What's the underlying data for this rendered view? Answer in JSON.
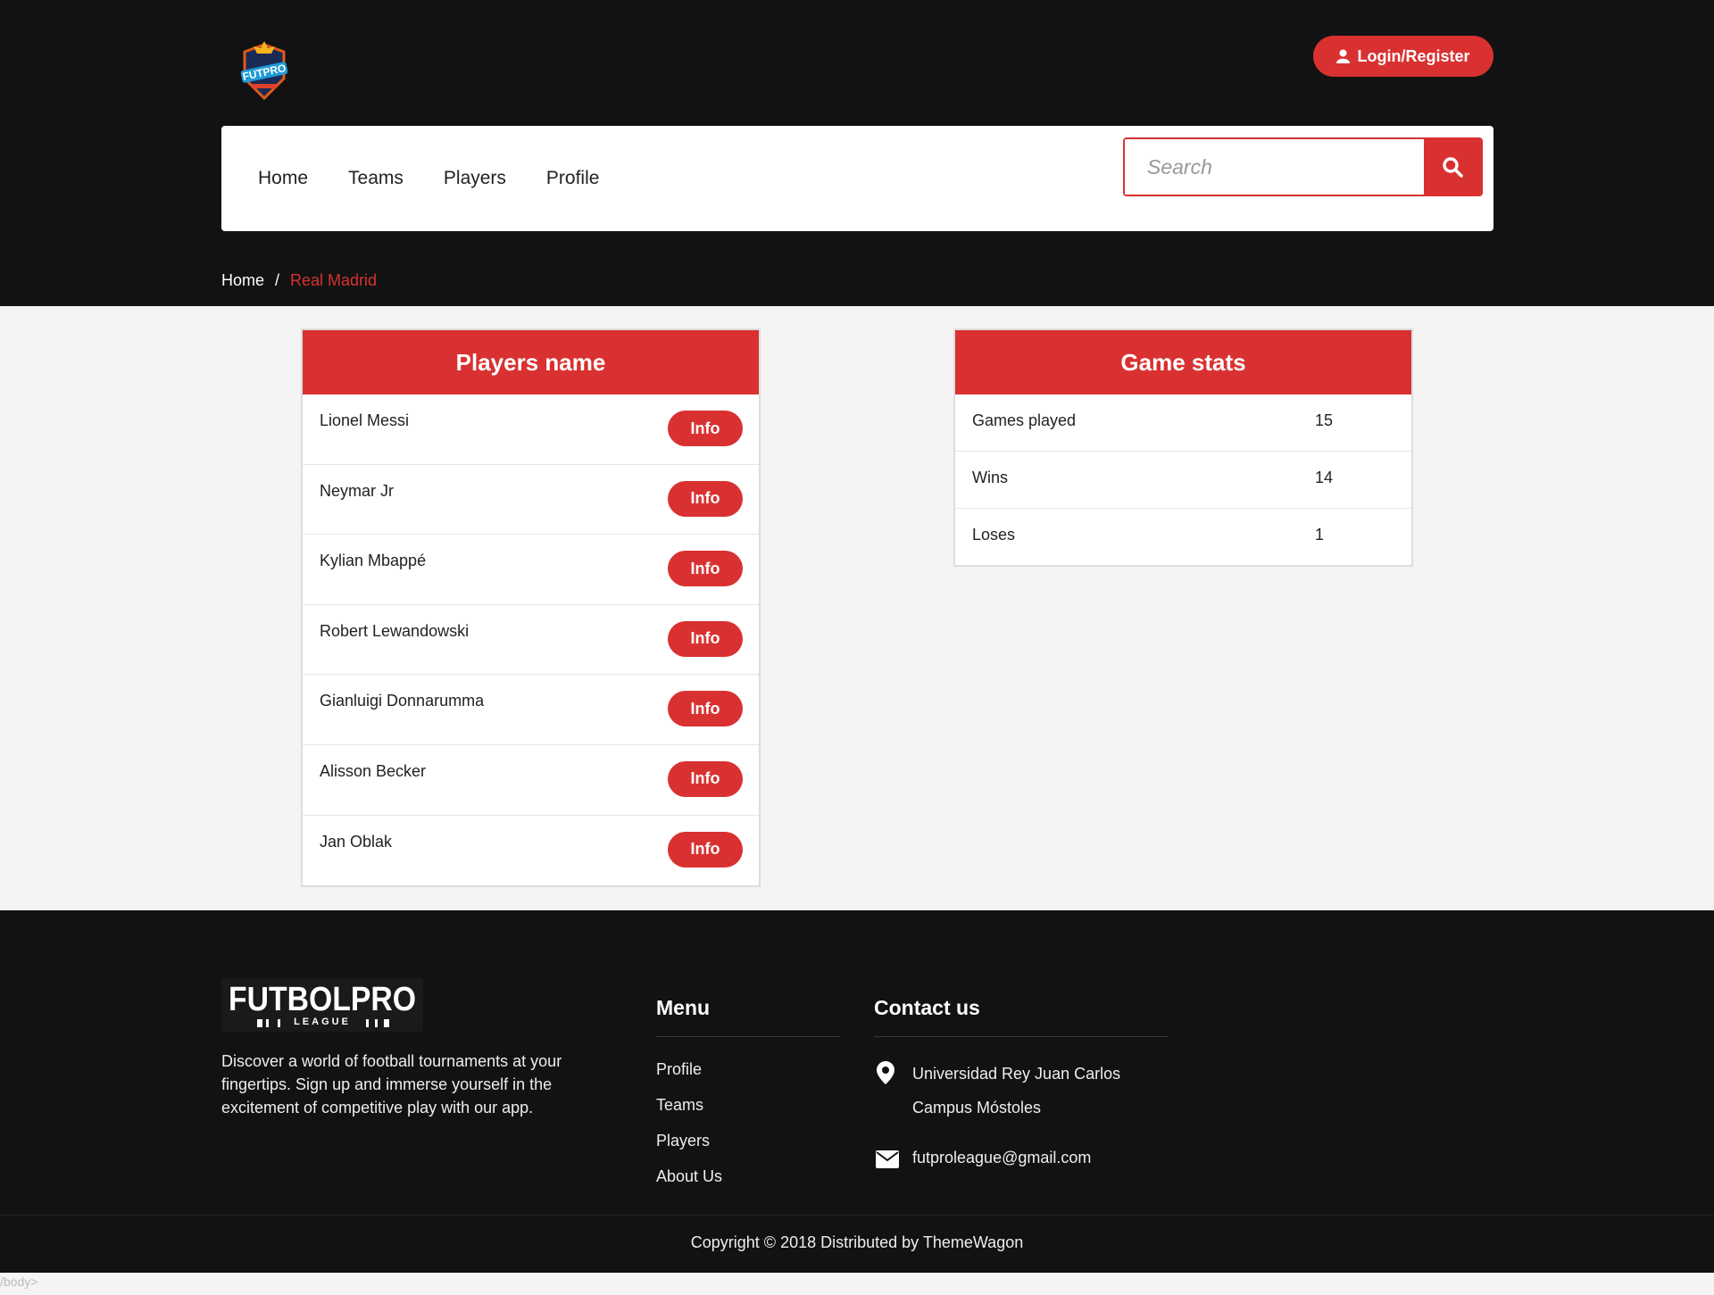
{
  "header": {
    "login_label": "Login/Register",
    "nav": [
      "Home",
      "Teams",
      "Players",
      "Profile"
    ],
    "search_placeholder": "Search"
  },
  "breadcrumb": {
    "home": "Home",
    "separator": "/",
    "current": "Real Madrid"
  },
  "players_card": {
    "title": "Players name",
    "button_label": "Info",
    "players": [
      "Lionel Messi",
      "Neymar Jr",
      "Kylian Mbappé",
      "Robert Lewandowski",
      "Gianluigi Donnarumma",
      "Alisson Becker",
      "Jan Oblak"
    ]
  },
  "stats_card": {
    "title": "Game stats",
    "rows": [
      {
        "label": "Games played",
        "value": "15"
      },
      {
        "label": "Wins",
        "value": "14"
      },
      {
        "label": "Loses",
        "value": "1"
      }
    ]
  },
  "footer": {
    "logo_text": "FUTBOLPRO",
    "logo_subtext": "LEAGUE",
    "description": "Discover a world of football tournaments at your fingertips. Sign up and immerse yourself in the excitement of competitive play with our app.",
    "menu_title": "Menu",
    "menu_items": [
      "Profile",
      "Teams",
      "Players",
      "About Us"
    ],
    "contact_title": "Contact us",
    "address_line1": "Universidad Rey Juan Carlos",
    "address_line2": "Campus Móstoles",
    "email": "futproleague@gmail.com",
    "copyright": "Copyright © 2018 Distributed by ThemeWagon"
  },
  "body_tag": "/body>",
  "colors": {
    "accent": "#d93131",
    "dark": "#121212",
    "page_bg": "#f4f4f4"
  }
}
